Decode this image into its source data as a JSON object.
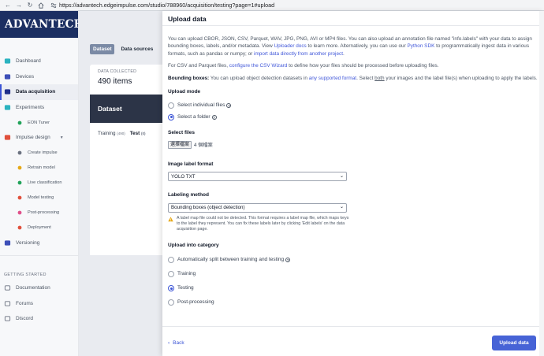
{
  "browser": {
    "url": "https://advantech.edgeimpulse.com/studio/788960/acquisition/testing?page=1#upload"
  },
  "sidebar": {
    "logo": "ADVANTECH",
    "items": [
      {
        "label": "Dashboard",
        "icon": "dashboard-icon",
        "color": "#2bb3c0"
      },
      {
        "label": "Devices",
        "icon": "devices-icon",
        "color": "#3d4fb8"
      },
      {
        "label": "Data acquisition",
        "icon": "data-acquisition-icon",
        "color": "#1f2f8a",
        "active": true
      },
      {
        "label": "Experiments",
        "icon": "experiments-icon",
        "color": "#2bb3c0"
      },
      {
        "label": "EON Tuner",
        "icon": "eon-tuner-icon",
        "color": "#22a35a",
        "sub": true
      },
      {
        "label": "Impulse design",
        "icon": "impulse-design-icon",
        "color": "#e0503c",
        "expand": true
      },
      {
        "label": "Create impulse",
        "icon": "dot-icon",
        "color": "#6b7280",
        "sub": true
      },
      {
        "label": "Retrain model",
        "icon": "retrain-icon",
        "color": "#e6a817",
        "sub": true
      },
      {
        "label": "Live classification",
        "icon": "live-classification-icon",
        "color": "#22a35a",
        "sub": true
      },
      {
        "label": "Model testing",
        "icon": "model-testing-icon",
        "color": "#e0503c",
        "sub": true
      },
      {
        "label": "Post-processing",
        "icon": "post-processing-icon",
        "color": "#e0508a",
        "sub": true
      },
      {
        "label": "Deployment",
        "icon": "deployment-icon",
        "color": "#e0503c",
        "sub": true
      },
      {
        "label": "Versioning",
        "icon": "versioning-icon",
        "color": "#3d4fb8"
      }
    ],
    "section_title": "GETTING STARTED",
    "bottom_items": [
      {
        "label": "Documentation",
        "icon": "documentation-icon"
      },
      {
        "label": "Forums",
        "icon": "forums-icon"
      },
      {
        "label": "Discord",
        "icon": "discord-icon"
      }
    ]
  },
  "background": {
    "tab_dataset": "Dataset",
    "tab_sources": "Data sources",
    "collected_label": "DATA COLLECTED",
    "collected_value": "490 items",
    "dataset_title": "Dataset",
    "training_label": "Training",
    "training_count": "(490)",
    "test_label": "Test",
    "test_count": "(0)"
  },
  "modal": {
    "title": "Upload data",
    "intro": {
      "t1": "You can upload CBOR, JSON, CSV, Parquet, WAV, JPG, PNG, AVI or MP4 files. You can also upload an annotation file named \"info.labels\" with your data to assign bounding boxes, labels, and/or metadata. View ",
      "link1": "Uploader docs",
      "t2": " to learn more. Alternatively, you can use our ",
      "link2": "Python SDK",
      "t3": " to programmatically ingest data in various formats, such as pandas or numpy; or ",
      "link3": "import data directly from another project",
      "t4": "."
    },
    "csv": {
      "t1": "For CSV and Parquet files, ",
      "link1": "configure the CSV Wizard",
      "t2": " to define how your files should be processed before uploading files."
    },
    "bbox": {
      "strong": "Bounding boxes:",
      "t1": " You can upload object detection datasets in ",
      "link1": "any supported format",
      "t2": ". Select ",
      "both": "both",
      "t3": " your images and the label file(s) when uploading to apply the labels."
    },
    "upload_mode": {
      "label": "Upload mode",
      "option_files": "Select individual files",
      "option_folder": "Select a folder",
      "selected": "folder"
    },
    "select_files": {
      "label": "Select files",
      "button": "選擇檔案",
      "count": "4 個檔案"
    },
    "image_label_format": {
      "label": "Image label format",
      "value": "YOLO TXT"
    },
    "labeling_method": {
      "label": "Labeling method",
      "value": "Bounding boxes (object detection)",
      "warning": "A label map file could not be detected. This format requires a label map file, which maps keys to the label they represent. You can fix these labels later by clicking 'Edit labels' on the data acquisition page."
    },
    "category": {
      "label": "Upload into category",
      "options": [
        "Automatically split between training and testing",
        "Training",
        "Testing",
        "Post-processing"
      ],
      "selected": "Testing"
    },
    "back": "Back",
    "submit": "Upload data"
  },
  "colors": {
    "accent": "#4763d6",
    "navy": "#1c2f62",
    "warning": "#e6a817"
  }
}
